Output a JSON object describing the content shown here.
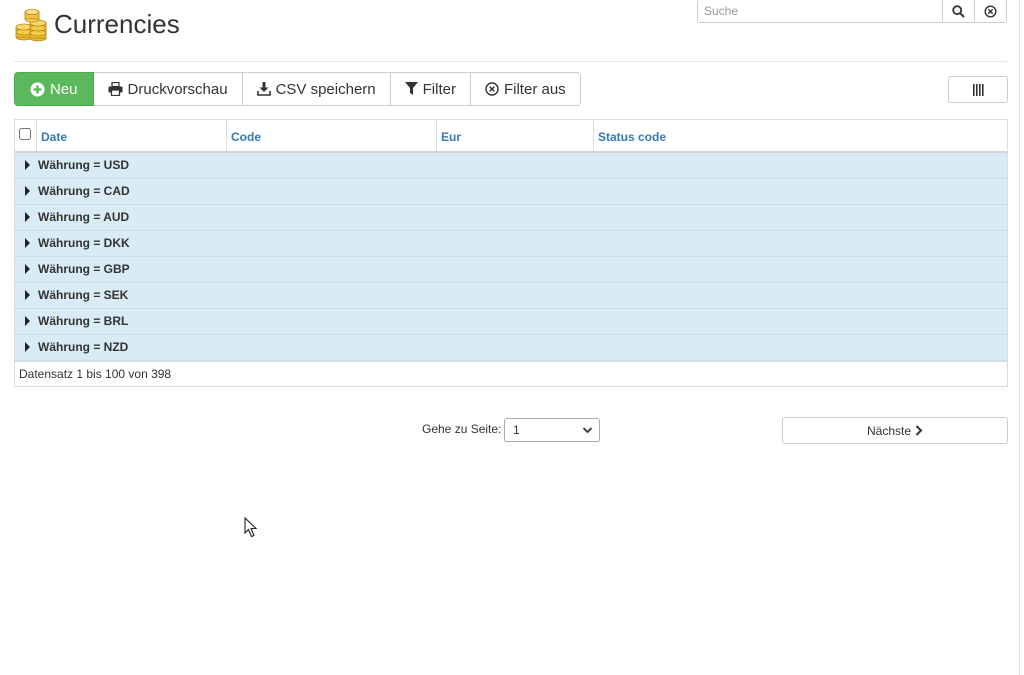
{
  "header": {
    "title": "Currencies",
    "icon": "coins-stack-icon"
  },
  "search": {
    "placeholder": "Suche",
    "value": ""
  },
  "toolbar": {
    "new_label": "Neu",
    "print_label": "Druckvorschau",
    "csv_label": "CSV speichern",
    "filter_label": "Filter",
    "filter_off_label": "Filter aus"
  },
  "table": {
    "columns": [
      "Date",
      "Code",
      "Eur",
      "Status code"
    ],
    "groups": [
      "Währung = USD",
      "Währung = CAD",
      "Währung = AUD",
      "Währung = DKK",
      "Währung = GBP",
      "Währung = SEK",
      "Währung = BRL",
      "Währung = NZD"
    ],
    "record_info": "Datensatz 1 bis 100 von 398"
  },
  "pagination": {
    "goto_label": "Gehe zu Seite:",
    "current_page": "1",
    "next_label": "Nächste"
  },
  "colors": {
    "primary_green": "#5cb85c",
    "link_blue": "#337ab7",
    "group_row_bg": "#d9ebf5"
  }
}
